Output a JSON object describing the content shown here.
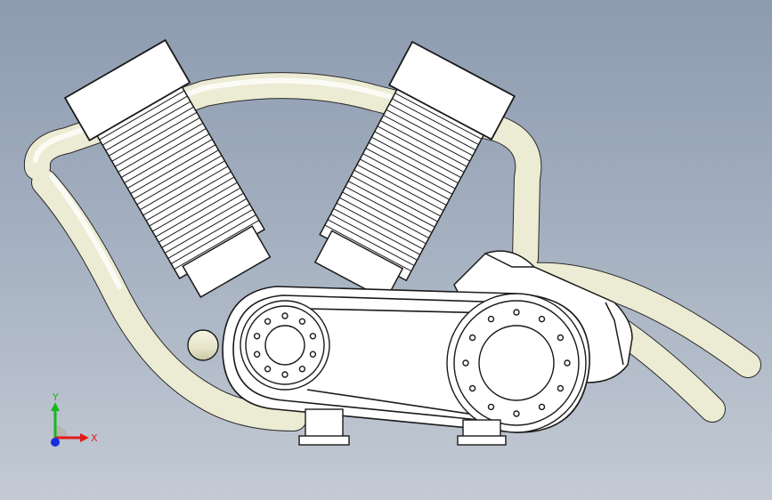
{
  "viewport": {
    "view_name": "engine-model-front-view"
  },
  "triad": {
    "x_label": "X",
    "y_label": "Y",
    "x_color": "#e01b1b",
    "y_color": "#18b81b",
    "z_color": "#1a2ee0"
  },
  "model": {
    "tube_color": "#e9e8cf",
    "body_color": "#ffffff",
    "edge_color": "#1a1a1a"
  }
}
